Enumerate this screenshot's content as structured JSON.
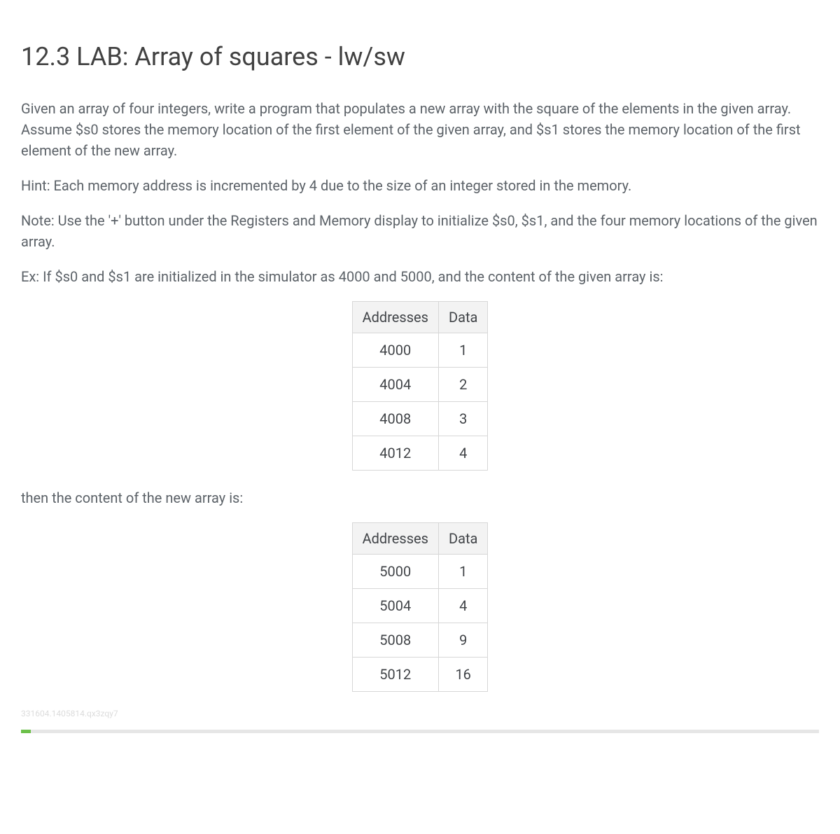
{
  "title": "12.3 LAB: Array of squares - lw/sw",
  "para1": "Given an array of four integers, write a program that populates a new array with the square of the elements in the given array. Assume $s0 stores the memory location of the first element of the given array, and $s1 stores the memory location of the first element of the new array.",
  "para2": "Hint: Each memory address is incremented by 4 due to the size of an integer stored in the memory.",
  "para3": "Note: Use the '+' button under the Registers and Memory display to initialize $s0, $s1, and the four memory locations of the given array.",
  "para4": "Ex: If $s0 and $s1 are initialized in the simulator as 4000 and 5000, and the content of the given array is:",
  "table1": {
    "headers": {
      "addresses": "Addresses",
      "data": "Data"
    },
    "rows": [
      {
        "address": "4000",
        "data": "1"
      },
      {
        "address": "4004",
        "data": "2"
      },
      {
        "address": "4008",
        "data": "3"
      },
      {
        "address": "4012",
        "data": "4"
      }
    ]
  },
  "para5": "then the content of the new array is:",
  "table2": {
    "headers": {
      "addresses": "Addresses",
      "data": "Data"
    },
    "rows": [
      {
        "address": "5000",
        "data": "1"
      },
      {
        "address": "5004",
        "data": "4"
      },
      {
        "address": "5008",
        "data": "9"
      },
      {
        "address": "5012",
        "data": "16"
      }
    ]
  },
  "watermark": "331604.1405814.qx3zqy7"
}
